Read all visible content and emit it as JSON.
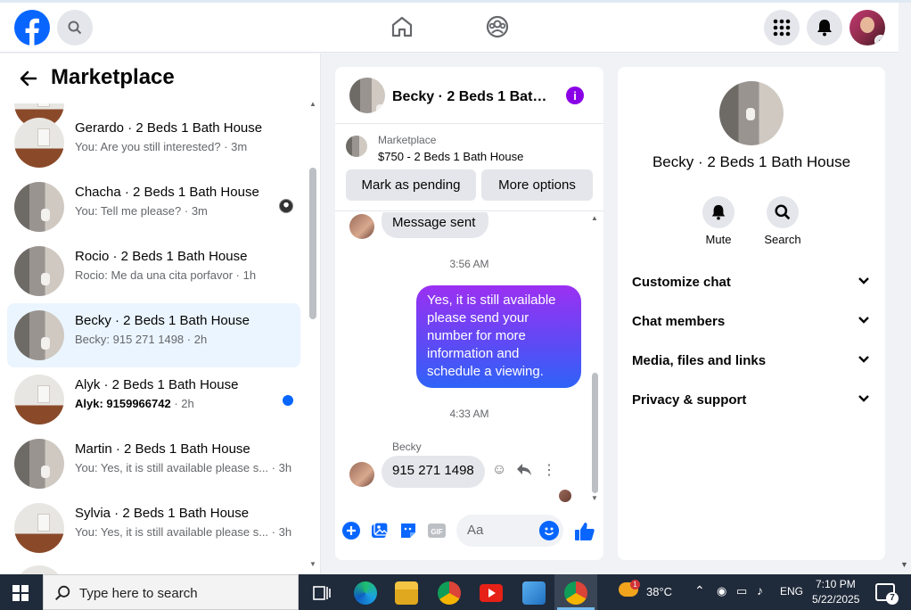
{
  "nav": {
    "logo": "facebook-logo",
    "search_icon": "search-icon",
    "home_icon": "home-icon",
    "groups_icon": "groups-icon",
    "menu_icon": "apps-grid-icon",
    "notifications_icon": "bell-icon"
  },
  "sidebar": {
    "title": "Marketplace",
    "conversations": [
      {
        "name": "Gerardo · 2 Beds 1 Bath House",
        "preview": "You: Are you still interested?",
        "time": "3m",
        "thumb": "room",
        "unread": false
      },
      {
        "name": "Chacha · 2 Beds 1 Bath House",
        "preview": "You: Tell me please?",
        "time": "3m",
        "thumb": "bath",
        "unread": false,
        "seen_avatar": true
      },
      {
        "name": "Rocio · 2 Beds 1 Bath House",
        "preview": "Rocio: Me da una cita porfavor",
        "time": "1h",
        "thumb": "bath",
        "unread": false
      },
      {
        "name": "Becky · 2 Beds 1 Bath House",
        "preview": "Becky: 915 271 1498",
        "time": "2h",
        "thumb": "bath",
        "unread": false,
        "active": true
      },
      {
        "name": "Alyk · 2 Beds 1 Bath House",
        "preview": "Alyk: 9159966742",
        "time": "2h",
        "thumb": "room",
        "unread": true
      },
      {
        "name": "Martin · 2 Beds 1 Bath House",
        "preview": "You: Yes, it is still available please s...",
        "time": "3h",
        "thumb": "bath",
        "unread": false
      },
      {
        "name": "Sylvia · 2 Beds 1 Bath House",
        "preview": "You: Yes, it is still available please s...",
        "time": "3h",
        "thumb": "room",
        "unread": false
      }
    ]
  },
  "chat": {
    "title": "Becky · 2 Beds 1 Bath House",
    "listing_kicker": "Marketplace",
    "listing_price": "$750 - 2 Beds 1 Bath House",
    "mark_pending": "Mark as pending",
    "more_options": "More options",
    "msg_sent": "Message sent",
    "time1": "3:56 AM",
    "outgoing": "Yes, it is still available please send your number for more information and schedule a viewing.",
    "time2": "4:33 AM",
    "sender": "Becky",
    "incoming": "915 271 1498",
    "composer_placeholder": "Aa"
  },
  "details": {
    "name": "Becky · 2 Beds 1 Bath House",
    "mute": "Mute",
    "search": "Search",
    "sections": [
      "Customize chat",
      "Chat members",
      "Media, files and links",
      "Privacy & support"
    ]
  },
  "taskbar": {
    "search_placeholder": "Type here to search",
    "temperature": "38°C",
    "language": "ENG",
    "time": "7:10 PM",
    "date": "5/22/2025",
    "notification_count": "7",
    "weather_badge": "1"
  }
}
